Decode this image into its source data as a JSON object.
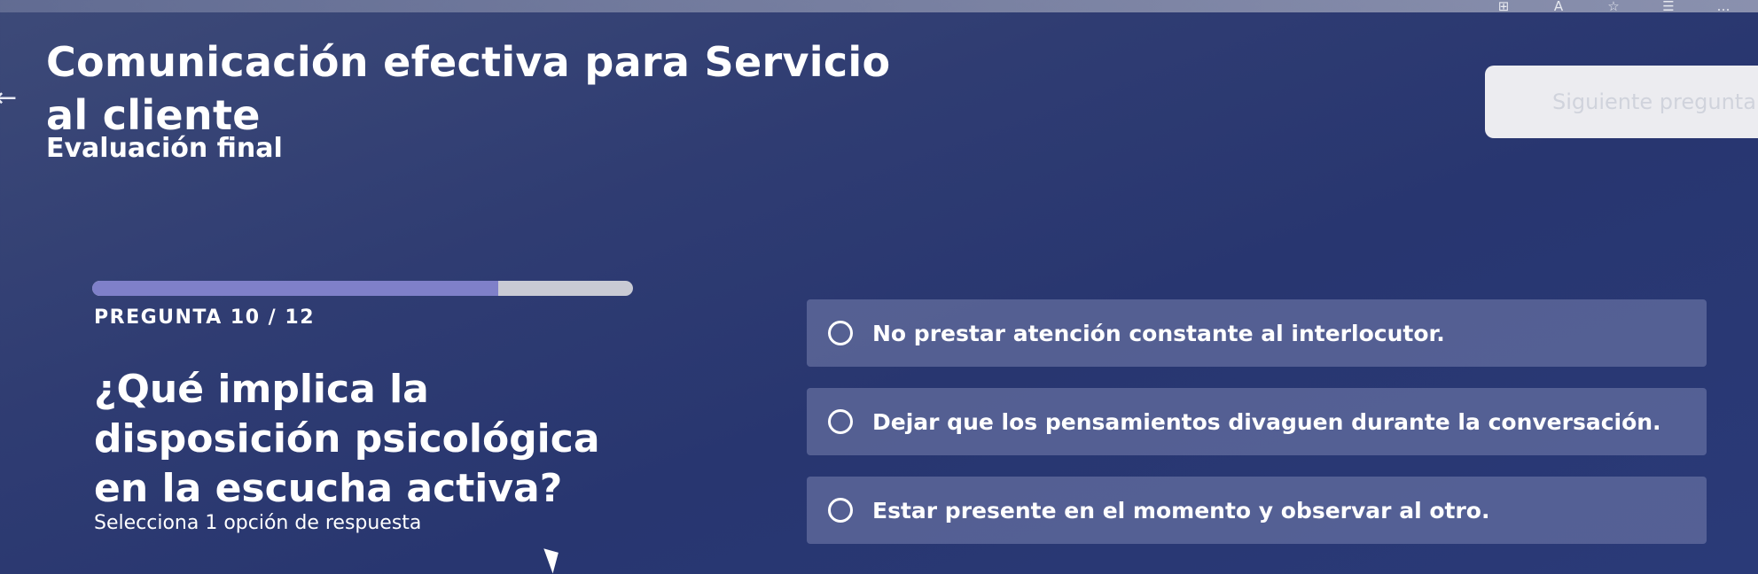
{
  "header": {
    "course_title": "Comunicación efectiva para Servicio al cliente",
    "section_title": "Evaluación final",
    "next_button_label": "Siguiente pregunta",
    "back_icon": "←"
  },
  "browser": {
    "icons": [
      "⊞",
      "A",
      "☆",
      "☰",
      "…"
    ]
  },
  "question": {
    "counter": "PREGUNTA 10 / 12",
    "progress": 0.75,
    "text": "¿Qué implica la disposición psicológica en la escucha activa?",
    "instructions": "Selecciona 1 opción de respuesta",
    "options": [
      {
        "label": "No prestar atención constante al interlocutor."
      },
      {
        "label": "Dejar que los pensamientos divaguen durante la conversación."
      },
      {
        "label": "Estar presente en el momento y observar al otro."
      }
    ]
  },
  "colors": {
    "background": "#2f3c72",
    "progress_fill": "#7f80c9",
    "option_bg": "#6e78a8"
  }
}
